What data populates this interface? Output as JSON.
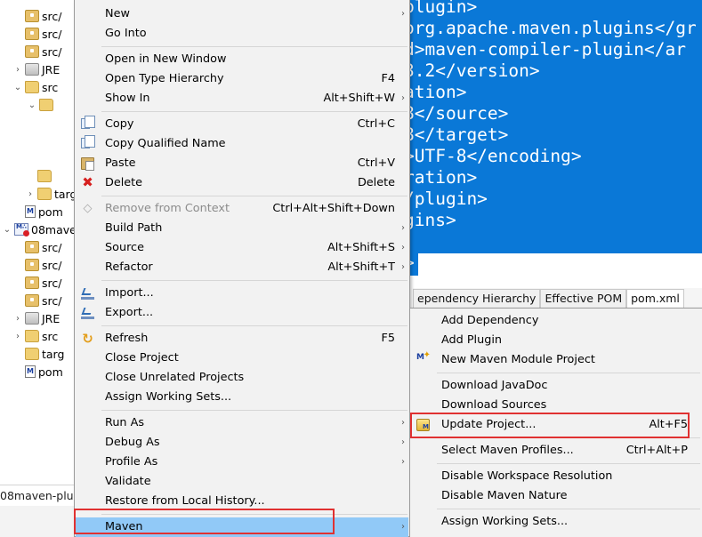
{
  "explorer": {
    "rows": [
      {
        "label": "src/",
        "icon": "package-icon",
        "twisty": ""
      },
      {
        "label": "src/",
        "icon": "package-icon",
        "twisty": ""
      },
      {
        "label": "src/",
        "icon": "package-icon",
        "twisty": ""
      },
      {
        "label": "JRE",
        "icon": "jre-library-icon",
        "twisty": "›"
      },
      {
        "label": "src",
        "icon": "folder-icon",
        "twisty": "⌄"
      },
      {
        "label": "",
        "icon": "folder-icon",
        "twisty": "⌄"
      },
      {
        "label": "",
        "icon": "",
        "twisty": ""
      },
      {
        "label": "",
        "icon": "",
        "twisty": ""
      },
      {
        "label": "",
        "icon": "",
        "twisty": ""
      },
      {
        "label": "",
        "icon": "folder-icon",
        "twisty": ""
      },
      {
        "label": "targ",
        "icon": "folder-icon",
        "twisty": "›"
      },
      {
        "label": "pom",
        "icon": "pom-file-icon",
        "twisty": ""
      },
      {
        "label": "08mave",
        "icon": "maven-project-error-icon",
        "twisty": "⌄"
      },
      {
        "label": "src/",
        "icon": "package-icon",
        "twisty": ""
      },
      {
        "label": "src/",
        "icon": "package-icon",
        "twisty": ""
      },
      {
        "label": "src/",
        "icon": "package-icon",
        "twisty": ""
      },
      {
        "label": "src/",
        "icon": "package-icon",
        "twisty": ""
      },
      {
        "label": "JRE",
        "icon": "jre-library-icon",
        "twisty": "›"
      },
      {
        "label": "src",
        "icon": "folder-icon",
        "twisty": "›"
      },
      {
        "label": "targ",
        "icon": "folder-icon",
        "twisty": ""
      },
      {
        "label": "pom",
        "icon": "pom-file-icon",
        "twisty": ""
      }
    ],
    "bottom_label": "08maven-plug"
  },
  "editor": {
    "lines": [
      "plugin>",
      "org.apache.maven.plugins</gr",
      "d>maven-compiler-plugin</ar",
      "3.2</version>",
      "ation>",
      "8</source>",
      "8</target>",
      ">UTF-8</encoding>",
      "ration>",
      "/plugin>",
      "gins>",
      "",
      ">"
    ]
  },
  "pom_tabs": [
    {
      "label": "ependency Hierarchy",
      "active": false
    },
    {
      "label": "Effective POM",
      "active": false
    },
    {
      "label": "pom.xml",
      "active": true
    }
  ],
  "context_menu": {
    "items": [
      {
        "label": "New",
        "accel": "",
        "submenu": true,
        "icon": ""
      },
      {
        "label": "Go Into",
        "accel": "",
        "submenu": false,
        "icon": ""
      },
      {
        "sep": true
      },
      {
        "label": "Open in New Window",
        "accel": "",
        "submenu": false,
        "icon": ""
      },
      {
        "label": "Open Type Hierarchy",
        "accel": "F4",
        "submenu": false,
        "icon": ""
      },
      {
        "label": "Show In",
        "accel": "Alt+Shift+W",
        "submenu": true,
        "icon": ""
      },
      {
        "sep": true
      },
      {
        "label": "Copy",
        "accel": "Ctrl+C",
        "submenu": false,
        "icon": "copy-icon"
      },
      {
        "label": "Copy Qualified Name",
        "accel": "",
        "submenu": false,
        "icon": "copy-qualified-icon"
      },
      {
        "label": "Paste",
        "accel": "Ctrl+V",
        "submenu": false,
        "icon": "paste-icon"
      },
      {
        "label": "Delete",
        "accel": "Delete",
        "submenu": false,
        "icon": "delete-icon"
      },
      {
        "sep": true
      },
      {
        "label": "Remove from Context",
        "accel": "Ctrl+Alt+Shift+Down",
        "submenu": false,
        "icon": "remove-context-icon",
        "disabled": true
      },
      {
        "label": "Build Path",
        "accel": "",
        "submenu": true,
        "icon": ""
      },
      {
        "label": "Source",
        "accel": "Alt+Shift+S",
        "submenu": true,
        "icon": ""
      },
      {
        "label": "Refactor",
        "accel": "Alt+Shift+T",
        "submenu": true,
        "icon": ""
      },
      {
        "sep": true
      },
      {
        "label": "Import...",
        "accel": "",
        "submenu": false,
        "icon": "import-icon"
      },
      {
        "label": "Export...",
        "accel": "",
        "submenu": false,
        "icon": "export-icon"
      },
      {
        "sep": true
      },
      {
        "label": "Refresh",
        "accel": "F5",
        "submenu": false,
        "icon": "refresh-icon"
      },
      {
        "label": "Close Project",
        "accel": "",
        "submenu": false,
        "icon": ""
      },
      {
        "label": "Close Unrelated Projects",
        "accel": "",
        "submenu": false,
        "icon": ""
      },
      {
        "label": "Assign Working Sets...",
        "accel": "",
        "submenu": false,
        "icon": ""
      },
      {
        "sep": true
      },
      {
        "label": "Run As",
        "accel": "",
        "submenu": true,
        "icon": ""
      },
      {
        "label": "Debug As",
        "accel": "",
        "submenu": true,
        "icon": ""
      },
      {
        "label": "Profile As",
        "accel": "",
        "submenu": true,
        "icon": ""
      },
      {
        "label": "Validate",
        "accel": "",
        "submenu": false,
        "icon": ""
      },
      {
        "label": "Restore from Local History...",
        "accel": "",
        "submenu": false,
        "icon": ""
      },
      {
        "sep": true
      },
      {
        "label": "Maven",
        "accel": "",
        "submenu": true,
        "icon": "",
        "highlighted": true
      }
    ]
  },
  "maven_menu": {
    "items": [
      {
        "label": "Add Dependency",
        "accel": "",
        "icon": ""
      },
      {
        "label": "Add Plugin",
        "accel": "",
        "icon": ""
      },
      {
        "label": "New Maven Module Project",
        "accel": "",
        "icon": "new-maven-module-icon"
      },
      {
        "sep": true
      },
      {
        "label": "Download JavaDoc",
        "accel": "",
        "icon": ""
      },
      {
        "label": "Download Sources",
        "accel": "",
        "icon": ""
      },
      {
        "label": "Update Project...",
        "accel": "Alt+F5",
        "icon": "update-project-icon"
      },
      {
        "sep": true
      },
      {
        "label": "Select Maven Profiles...",
        "accel": "Ctrl+Alt+P",
        "icon": ""
      },
      {
        "sep": true
      },
      {
        "label": "Disable Workspace Resolution",
        "accel": "",
        "icon": ""
      },
      {
        "label": "Disable Maven Nature",
        "accel": "",
        "icon": ""
      },
      {
        "sep": true
      },
      {
        "label": "Assign Working Sets...",
        "accel": "",
        "icon": ""
      }
    ]
  },
  "colors": {
    "selection_blue": "#0a78d7",
    "menu_highlight": "#91c9f7",
    "annotation_red": "#e03131"
  }
}
